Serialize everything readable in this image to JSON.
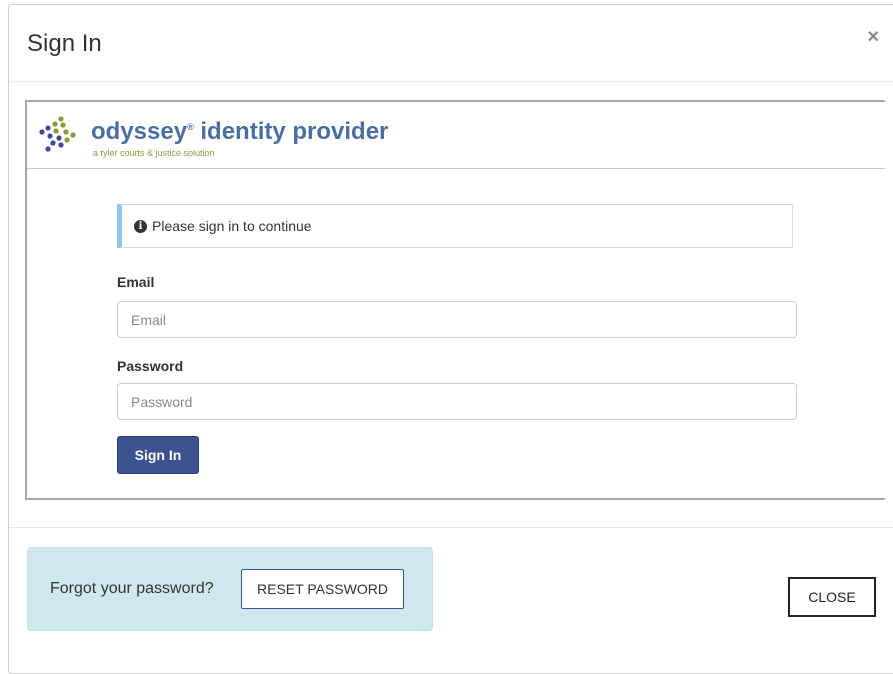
{
  "modal": {
    "title": "Sign In",
    "close_symbol": "×"
  },
  "brand": {
    "name": "odyssey",
    "registered": "®",
    "name_rest": " identity provider",
    "tagline": "a tyler courts & justice solution",
    "dot_colors": [
      "#3d4a9a",
      "#8a9a3c"
    ]
  },
  "alert": {
    "icon": "info-icon",
    "icon_glyph": "i",
    "message": "Please sign in to continue"
  },
  "form": {
    "email_label": "Email",
    "email_placeholder": "Email",
    "email_value": "",
    "password_label": "Password",
    "password_placeholder": "Password",
    "password_value": "",
    "submit_label": "Sign In"
  },
  "footer": {
    "forgot_text": "Forgot your password?",
    "reset_label": "RESET PASSWORD",
    "close_label": "CLOSE"
  },
  "colors": {
    "primary": "#3d5291",
    "alert_accent": "#8ec6ea",
    "reset_panel_bg": "#cde9ee"
  }
}
